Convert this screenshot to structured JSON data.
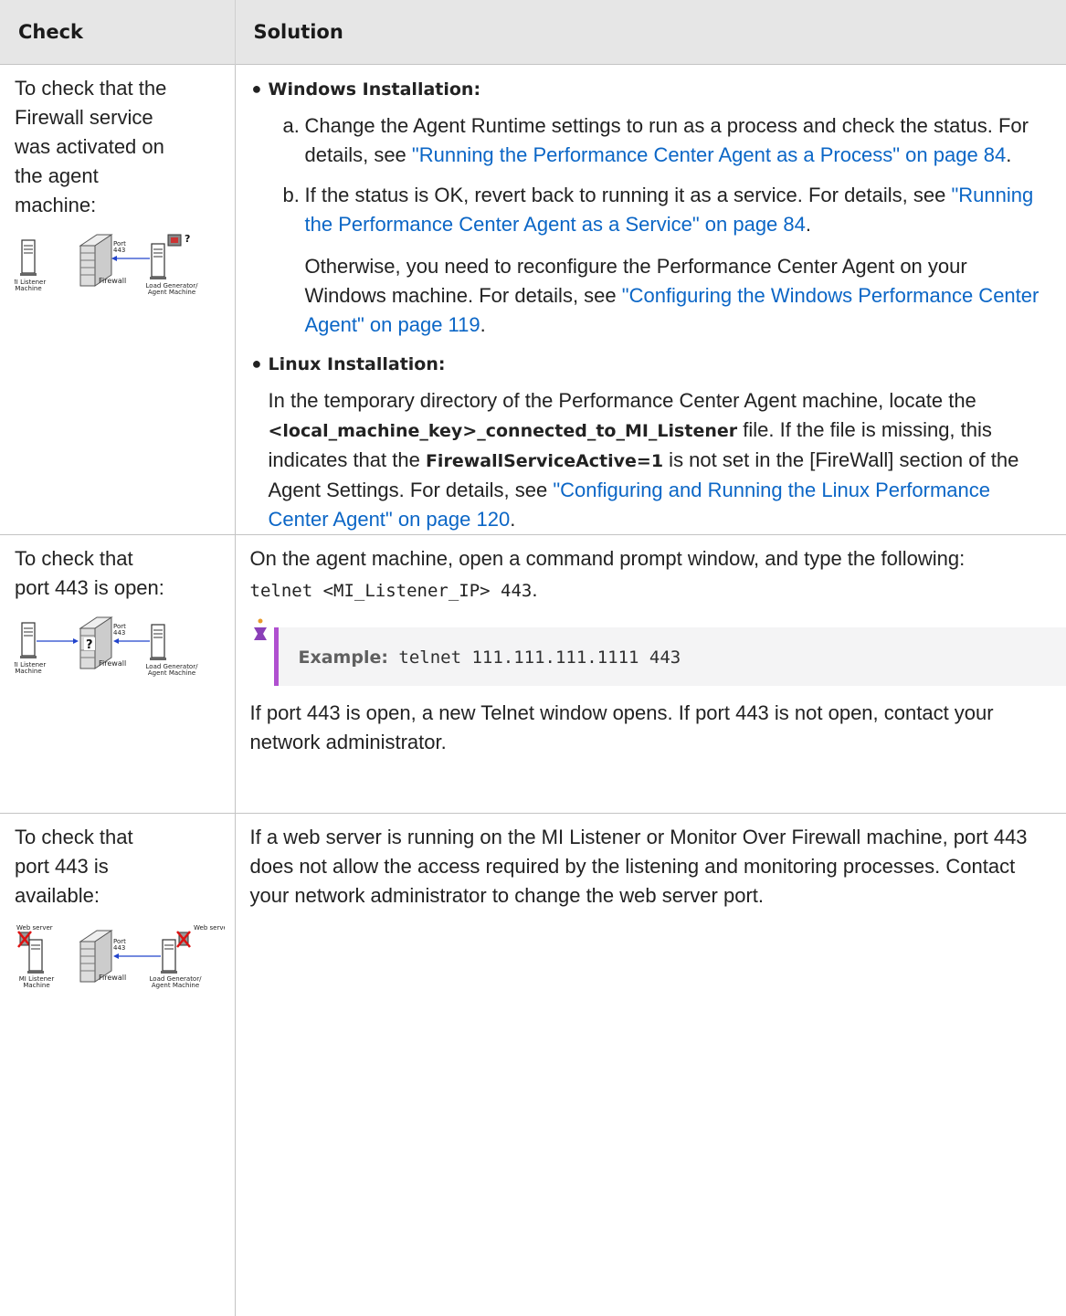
{
  "header": {
    "check": "Check",
    "solution": "Solution"
  },
  "rows": [
    {
      "check": " To check that the\nFirewall service\nwas activated on\nthe agent\nmachine:",
      "diagram": {
        "port": "Port",
        "port_num": "443",
        "firewall": "Firewall",
        "left_l1": "MI Listener",
        "left_l2": "Machine",
        "right_l1": "Load Generator/",
        "right_l2": "Agent Machine"
      },
      "windows_label": "Windows Installation:",
      "a_marker": "a.",
      "a_text": "Change the Agent Runtime settings to run as a process and check the status. For details, see ",
      "a_link": "\"Running the Performance Center Agent as a Process\" on page 84",
      "a_end": ".",
      "b_marker": "b.",
      "b_text": "If the status is OK, revert back to running it as a service. For details, see ",
      "b_link": "\"Running the Performance Center Agent as a Service\" on page 84",
      "b_end": ".",
      "otherwise_text": "Otherwise, you need to reconfigure the Performance Center Agent on your Windows machine. For details, see ",
      "otherwise_link": "\"Configuring the Windows Performance Center Agent\" on page 119",
      "otherwise_end": ".",
      "linux_label": "Linux Installation:",
      "linux_t1": "In the temporary directory of the Performance Center Agent machine, locate the ",
      "linux_b1": "<local_machine_key>_connected_to_MI_Listener",
      "linux_t2": " file. If the file is missing, this indicates that the ",
      "linux_b2": "FirewallServiceActive=1",
      "linux_t3": " is not set in the [FireWall] section of the Agent Settings. For details, see ",
      "linux_link": "\"Configuring and Running the Linux Performance Center Agent\" on page 120",
      "linux_end": "."
    },
    {
      "check": " To check that\nport 443 is open:",
      "diagram": {
        "port": "Port",
        "port_num": "443",
        "firewall": "Firewall",
        "left_l1": "MI Listener",
        "left_l2": "Machine",
        "right_l1": "Load Generator/",
        "right_l2": "Agent Machine"
      },
      "intro": "On the agent machine, open a command prompt window, and type the following:",
      "command": "telnet <MI_Listener_IP> 443",
      "command_end": ".",
      "example_label": "Example:",
      "example_code": " telnet 111.111.111.1111 443",
      "result": "If port 443 is open, a new Telnet window opens. If port 443 is not open, contact your network administrator."
    },
    {
      "check": " To check that\nport 443 is\navailable:",
      "diagram": {
        "web_left": "Web server",
        "web_right": "Web server",
        "port": "Port",
        "port_num": "443",
        "firewall": "Firewall",
        "left_l1": "MI Listener",
        "left_l2": "Machine",
        "right_l1": "Load Generator/",
        "right_l2": "Agent Machine"
      },
      "text": "If a web server is running on the MI Listener or Monitor Over Firewall machine, port 443 does not allow the access required by the listening and monitoring processes. Contact your network administrator to change the web server port."
    }
  ]
}
